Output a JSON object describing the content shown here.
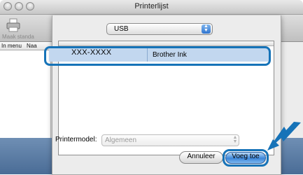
{
  "window": {
    "title": "Printerlijst"
  },
  "toolbar": {
    "default_label": "Maak standa"
  },
  "printer_list": {
    "columns": [
      "In menu",
      "Naa"
    ]
  },
  "sheet": {
    "connection": {
      "selected": "USB"
    },
    "printers": [
      {
        "name": "XXX-XXXX",
        "kind": "Brother Ink",
        "selected": true
      }
    ],
    "model": {
      "label": "Printermodel:",
      "value": "Algemeen"
    },
    "buttons": {
      "cancel": "Annuleer",
      "add": "Voeg toe"
    }
  },
  "colors": {
    "highlight": "#1673b8",
    "selection": "#c2d7ef",
    "default_button": "#3c86d9"
  },
  "icons": {
    "printer": "printer-icon",
    "arrow": "pointer-arrow-icon"
  }
}
